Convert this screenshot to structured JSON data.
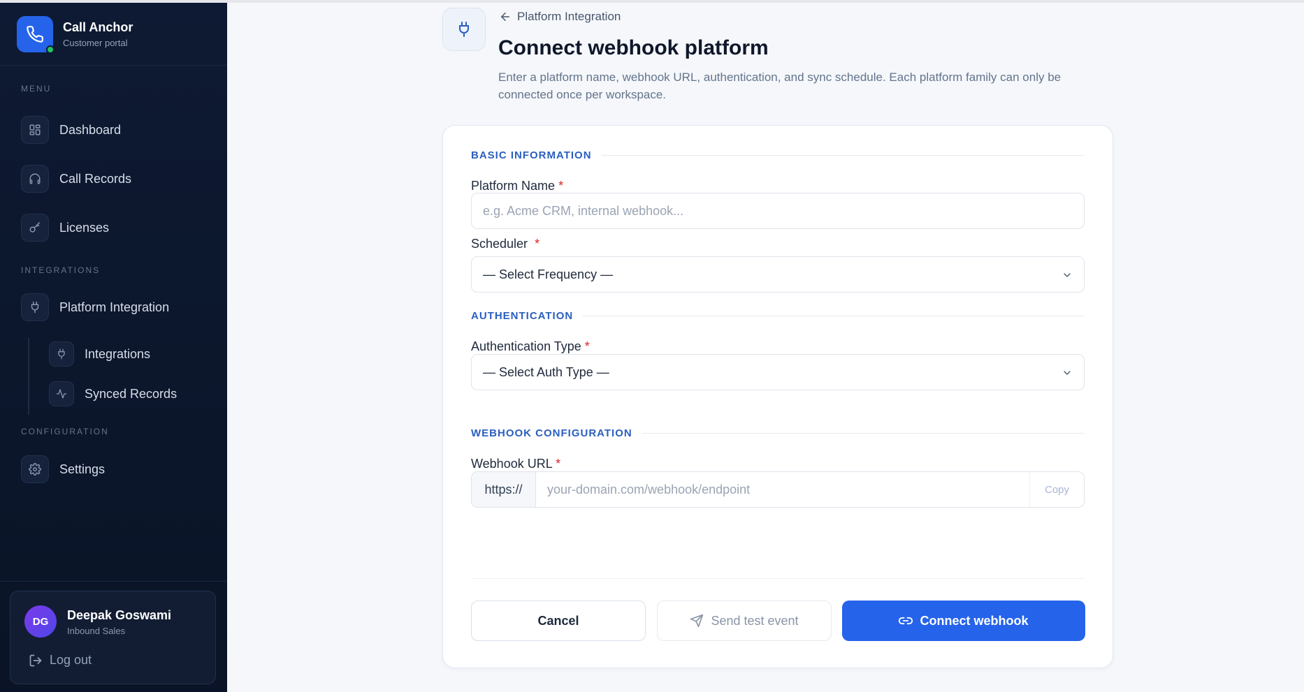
{
  "brand": {
    "title": "Call Anchor",
    "subtitle": "Customer portal"
  },
  "sidebar": {
    "sections": {
      "menu": "MENU",
      "integrations": "INTEGRATIONS",
      "configuration": "CONFIGURATION"
    },
    "items": [
      {
        "label": "Dashboard",
        "icon": "grid-icon"
      },
      {
        "label": "Call Records",
        "icon": "headphones-icon"
      },
      {
        "label": "Licenses",
        "icon": "key-icon"
      },
      {
        "label": "Platform Integration",
        "icon": "plug-icon"
      },
      {
        "label": "Integrations",
        "icon": "plug-icon"
      },
      {
        "label": "Synced Records",
        "icon": "activity-icon"
      },
      {
        "label": "Settings",
        "icon": "gear-icon"
      }
    ],
    "user": {
      "initials": "DG",
      "name": "Deepak Goswami",
      "role": "Inbound Sales",
      "logout": "Log out"
    }
  },
  "header": {
    "back_label": "Platform Integration",
    "title": "Connect webhook platform",
    "description": "Enter a platform name, webhook URL, authentication, and sync schedule. Each platform family can only be connected once per workspace."
  },
  "form": {
    "basic": {
      "section_title": "BASIC INFORMATION",
      "platform_name_label": "Platform Name",
      "platform_name_placeholder": "e.g. Acme CRM, internal webhook...",
      "scheduler_label": "Scheduler",
      "scheduler_value": "— Select Frequency —"
    },
    "auth": {
      "section_title": "AUTHENTICATION",
      "auth_type_label": "Authentication Type",
      "auth_type_value": "— Select Auth Type —"
    },
    "webhook": {
      "section_title": "WEBHOOK CONFIGURATION",
      "url_label": "Webhook URL",
      "url_prefix": "https://",
      "url_placeholder": "your-domain.com/webhook/endpoint",
      "copy_label": "Copy"
    },
    "required_mark": "*",
    "buttons": {
      "cancel": "Cancel",
      "test": "Send test event",
      "connect": "Connect webhook"
    }
  },
  "colors": {
    "accent": "#2563eb",
    "sidebar_bg": "#0e1a33",
    "section_title": "#2a5fbf",
    "required": "#dc2626",
    "online": "#22c55e"
  }
}
